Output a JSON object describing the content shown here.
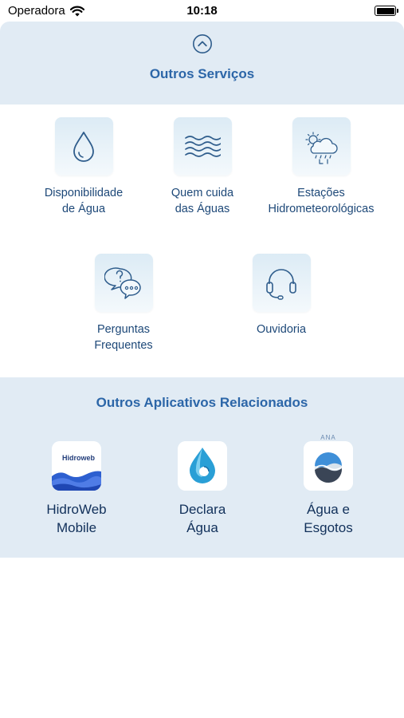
{
  "status_bar": {
    "carrier": "Operadora",
    "time": "10:18"
  },
  "services": {
    "title": "Outros Serviços",
    "items": [
      {
        "label": "Disponibilidade\nde Água",
        "icon": "water-drop-icon"
      },
      {
        "label": "Quem cuida\ndas Águas",
        "icon": "water-waves-icon"
      },
      {
        "label": "Estações\nHidrometeorológicas",
        "icon": "weather-station-icon"
      },
      {
        "label": "Perguntas\nFrequentes",
        "icon": "faq-chat-icon"
      },
      {
        "label": "Ouvidoria",
        "icon": "headset-icon"
      }
    ]
  },
  "apps": {
    "title": "Outros Aplicativos Relacionados",
    "items": [
      {
        "label": "HidroWeb\nMobile",
        "icon": "hidroweb-app-icon",
        "logo_text": "Hidroweb"
      },
      {
        "label": "Declara\nÁgua",
        "icon": "declara-agua-app-icon"
      },
      {
        "label": "Água e\nEsgotos",
        "icon": "agua-esgotos-app-icon",
        "tag": "ANA"
      }
    ]
  },
  "colors": {
    "header_bg": "#e1ebf4",
    "title": "#2c66a8",
    "icon_stroke": "#2f5d8c"
  }
}
